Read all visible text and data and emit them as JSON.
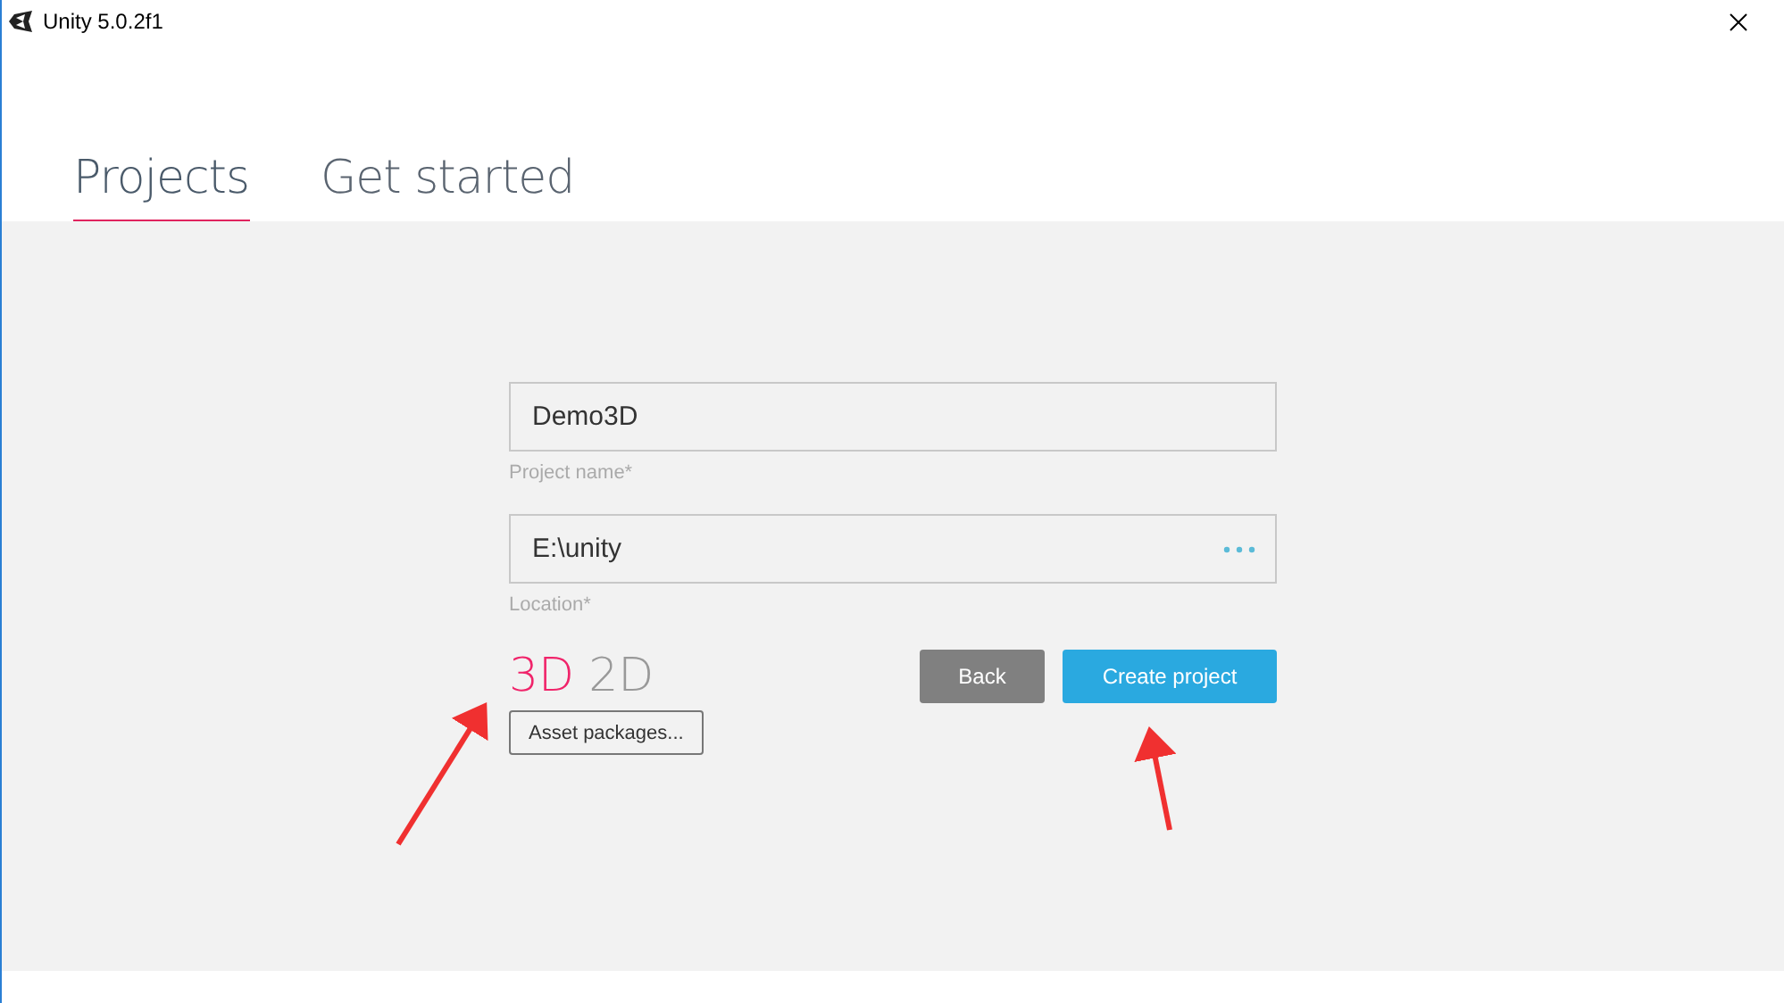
{
  "window": {
    "title": "Unity 5.0.2f1"
  },
  "tabs": [
    {
      "label": "Projects",
      "selected": true
    },
    {
      "label": "Get started",
      "selected": false
    }
  ],
  "form": {
    "fields": [
      {
        "value": "Demo3D",
        "label": "Project name*",
        "browse": false
      },
      {
        "value": "E:\\unity",
        "label": "Location*",
        "browse": true
      }
    ],
    "modes": [
      {
        "label": "3D",
        "selected": true
      },
      {
        "label": "2D",
        "selected": false
      }
    ],
    "asset_button": "Asset packages...",
    "buttons": [
      {
        "label": "Back",
        "kind": "secondary"
      },
      {
        "label": "Create project",
        "kind": "primary"
      }
    ]
  }
}
